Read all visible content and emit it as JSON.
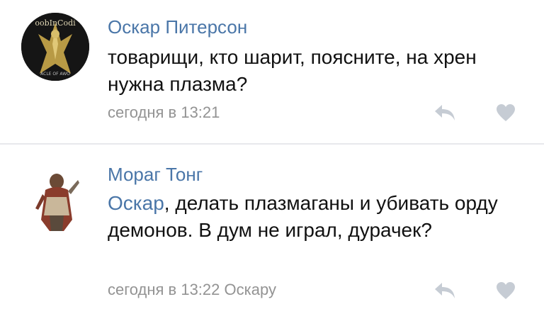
{
  "comments": [
    {
      "author": "Оскар Питерсон",
      "avatar_text_top": "oobInCodi",
      "avatar_text_bottom": "ACLE OF AWO",
      "text": "товарищи, кто шарит, поясните, на хрен нужна плазма?",
      "time": "сегодня в 13:21"
    },
    {
      "author": "Мораг Тонг",
      "mention": "Оскар",
      "text": ", делать плазмаганы и убивать орду демонов. В дум не играл, дурачек?",
      "time": "сегодня в 13:22",
      "reply_to": "Оскару"
    }
  ],
  "icons": {
    "reply": "reply-arrow-icon",
    "like": "heart-icon"
  },
  "colors": {
    "link": "#4a76a8",
    "meta": "#939393",
    "icon": "#c6ccd4",
    "divider": "#e7e8ec"
  }
}
